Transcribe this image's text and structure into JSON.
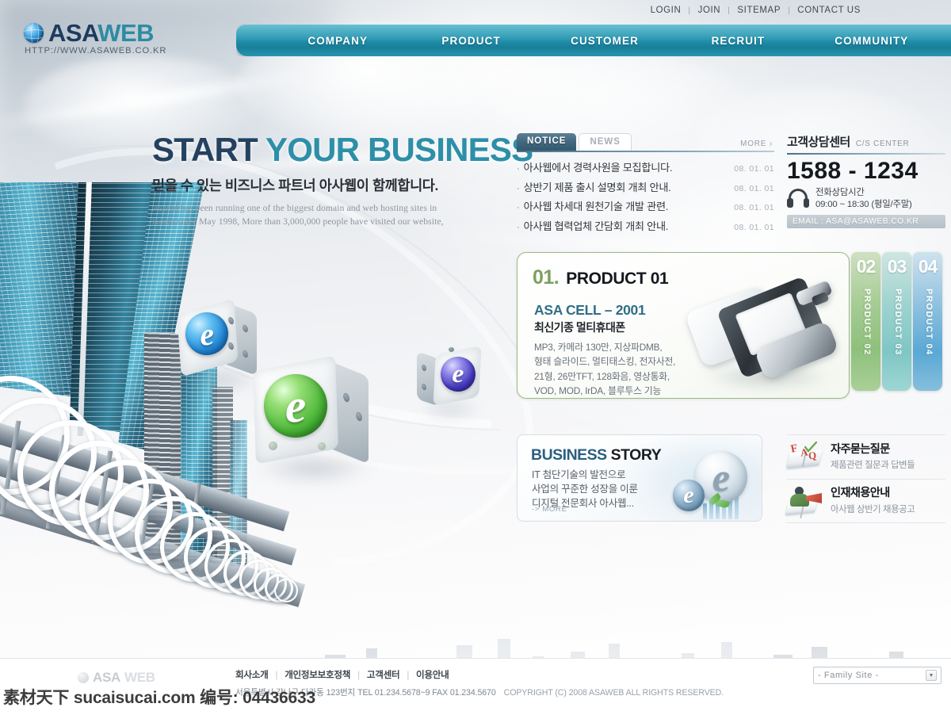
{
  "top": {
    "links": [
      {
        "label": "LOGIN"
      },
      {
        "label": "JOIN"
      },
      {
        "label": "SITEMAP"
      },
      {
        "label": "CONTACT US"
      }
    ]
  },
  "logo": {
    "name_a": "ASA",
    "name_b": "WEB",
    "url": "HTTP://WWW.ASAWEB.CO.KR",
    "icon": "globe-icon"
  },
  "nav": {
    "items": [
      {
        "label": "COMPANY"
      },
      {
        "label": "PRODUCT"
      },
      {
        "label": "CUSTOMER"
      },
      {
        "label": "RECRUIT"
      },
      {
        "label": "COMMUNITY"
      }
    ],
    "color": "#1f8fab"
  },
  "hero": {
    "title_1": "START ",
    "title_2": "YOUR BUSINESS",
    "subtitle": "믿을 수 있는 비즈니스 파트너 아사웹이 함께합니다.",
    "english_1": "Asadal has been running one of the biggest domain and web hosting sites in",
    "english_2": "Korea since May 1998, More than 3,000,000 people have visited our website,"
  },
  "notice": {
    "tabs": [
      {
        "label": "NOTICE",
        "active": true
      },
      {
        "label": "NEWS",
        "active": false
      }
    ],
    "more_label": "MORE ›",
    "items": [
      {
        "bullet": "·",
        "text": "아사웹에서 경력사원을 모집합니다.",
        "date": "08. 01. 01"
      },
      {
        "bullet": "·",
        "text": "상반기 제품 출시 설명회 개최 안내.",
        "date": "08. 01. 01"
      },
      {
        "bullet": "·",
        "text": "아사웹 차세대 원천기술 개발 관련.",
        "date": "08. 01. 01"
      },
      {
        "bullet": "·",
        "text": "아사웹 협력업체 간담회 개최 안내.",
        "date": "08. 01. 01"
      }
    ]
  },
  "cs_center": {
    "title": "고객상담센터",
    "subtitle": "C/S CENTER",
    "phone": "1588 - 1234",
    "hours_label": "전화상담시간",
    "hours_value": "09:00 ~ 18:30 (평일/주말)",
    "email": "EMAIL : ASA@ASAWEB.CO.KR",
    "icon": "headset-icon"
  },
  "product": {
    "number": "01.",
    "heading": "PRODUCT 01",
    "model": "ASA CELL – 2001",
    "model_kr": "최신기종 멀티휴대폰",
    "specs": [
      "MP3, 카메라 130만, 지상파DMB,",
      "형태 슬라이드, 멀티태스킹, 전자사전,",
      "21형, 26만TFT, 128화음, 영상통화,",
      "VOD, MOD, IrDA, 블루투스 기능"
    ],
    "image": "cell-phone-image",
    "tabs": [
      {
        "number": "02",
        "label": "PRODUCT 02",
        "color": "#8ec07c"
      },
      {
        "number": "03",
        "label": "PRODUCT 03",
        "color": "#7fc6c5"
      },
      {
        "number": "04",
        "label": "PRODUCT 04",
        "color": "#5aa8d4"
      }
    ]
  },
  "business_story": {
    "title_a": "BUSINESS ",
    "title_b": "STORY",
    "line1": "IT 첨단기술의 발전으로",
    "line2": "사업의 꾸준한 성장을 이룬",
    "line3": "디지털 전문회사 아사웹...",
    "more_label": "-> MORE",
    "art": "e-logo-graphic"
  },
  "side_links": [
    {
      "icon": "faq-book-icon",
      "title": "자주묻는질문",
      "desc": "제품관련 질문과 답변들"
    },
    {
      "icon": "recruit-person-icon",
      "title": "인재채용안내",
      "desc": "아사웹 상반기 채용공고"
    }
  ],
  "footer": {
    "logo_a": "ASA",
    "logo_b": "WEB",
    "nav": [
      {
        "label": "회사소개"
      },
      {
        "label": "개인정보보호정책"
      },
      {
        "label": "고객센터"
      },
      {
        "label": "이용안내"
      }
    ],
    "address": "서울특별시 강나구 다라동 123번지  TEL  01.234.5678~9  FAX  01.234.5670",
    "copyright": "COPYRIGHT (C) 2008 ASAWEB ALL RIGHTS RESERVED.",
    "family_site": "- Family Site -"
  },
  "watermark": {
    "text": "素材天下 sucaisucai.com  编号:  04436633"
  }
}
